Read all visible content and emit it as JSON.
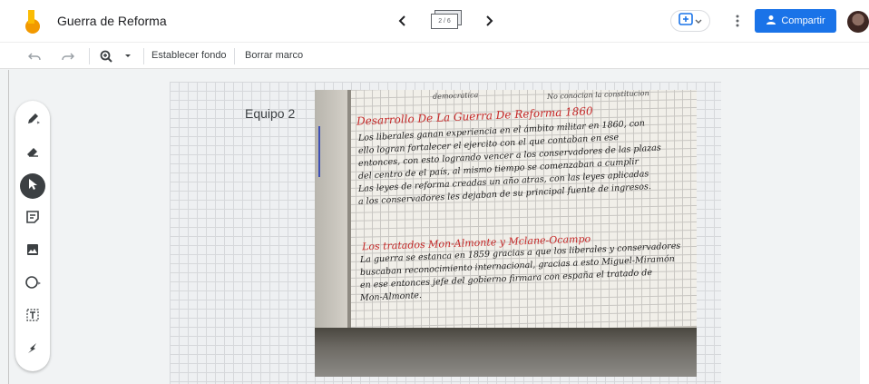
{
  "app": {
    "title": "Guerra de Reforma",
    "logo": "jamboard-logo"
  },
  "header": {
    "frame_indicator": "2 / 6",
    "prev_icon": "chevron-left-icon",
    "next_icon": "chevron-right-icon",
    "add_frame_icon": "add-frame-icon",
    "more_icon": "more-vert-icon",
    "share_label": "Compartir",
    "share_icon": "person-add-icon"
  },
  "toolbar": {
    "undo_icon": "undo-icon",
    "redo_icon": "redo-icon",
    "zoom_icon": "zoom-in-icon",
    "set_background_label": "Establecer fondo",
    "clear_frame_label": "Borrar marco"
  },
  "tools": [
    {
      "name": "pen-tool",
      "icon": "pen-icon"
    },
    {
      "name": "eraser-tool",
      "icon": "eraser-icon"
    },
    {
      "name": "select-tool",
      "icon": "cursor-icon",
      "active": true
    },
    {
      "name": "sticky-note-tool",
      "icon": "sticky-note-icon"
    },
    {
      "name": "image-tool",
      "icon": "image-icon"
    },
    {
      "name": "shape-tool",
      "icon": "circle-icon"
    },
    {
      "name": "text-box-tool",
      "icon": "text-box-icon"
    },
    {
      "name": "laser-tool",
      "icon": "laser-icon"
    }
  ],
  "canvas": {
    "team_label": "Equipo 2",
    "photo": {
      "top_left_text": "democratica",
      "top_right_text": "No conocian la constitucion",
      "heading1": "Desarrollo De La Guerra De Reforma 1860",
      "body1": [
        "Los liberales ganan experiencia en el ámbito militar en 1860, con",
        "ello logran fortalecer el ejercito con el que contaban en ese",
        "entonces, con esto logrando vencer a los conservadores de las plazas",
        "del centro de el país, al mismo tiempo se comenzaban a cumplir",
        "Las leyes de reforma creadas un año atras, con las leyes aplicadas",
        "a los conservadores les dejaban de su principal fuente de ingresos."
      ],
      "heading2": "Los tratados Mon-Almonte y Mclane-Ocampo",
      "body2": [
        "La guerra se estanca en 1859 gracias a que los liberales y conservadores",
        "buscaban reconocimiento internacional, gracias a esto Miguel-Miramón",
        "en ese entonces jefe del gobierno firmara con españa el tratado de",
        "Mon-Almonte."
      ]
    }
  },
  "colors": {
    "accent": "#1a73e8",
    "active_tool": "#3c4043",
    "logo_yellow": "#fbbc04",
    "logo_orange": "#f29900",
    "red_ink": "#c62828"
  }
}
